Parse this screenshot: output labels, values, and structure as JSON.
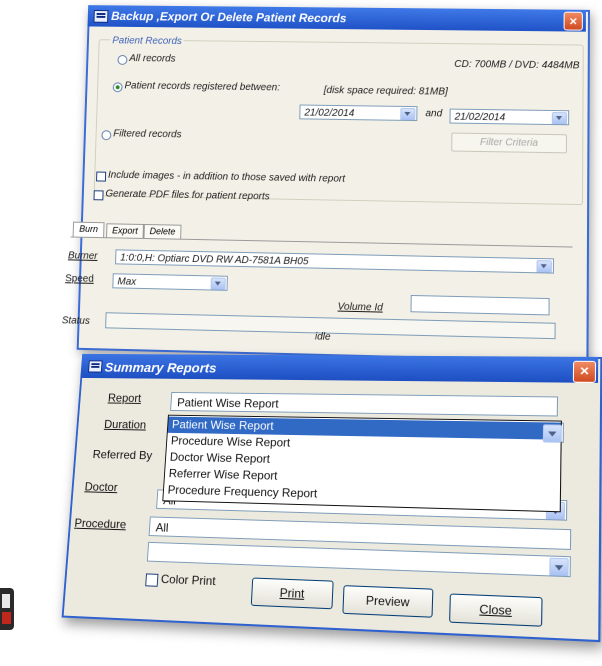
{
  "backup_window": {
    "title": "Backup ,Export Or Delete Patient Records",
    "group_label": "Patient Records",
    "all_records": "All records",
    "capacity": "CD: 700MB / DVD: 4484MB",
    "registered_between": "Patient records registered between:",
    "disk_space": "[disk space required: 81MB]",
    "date_from": "21/02/2014",
    "date_and": "and",
    "date_to": "21/02/2014",
    "filtered_records": "Filtered records",
    "filter_criteria_button": "Filter Criteria",
    "include_images": "Include images - in addition to those saved with report",
    "generate_pdf": "Generate PDF files for patient reports",
    "tabs": [
      "Burn",
      "Export",
      "Delete"
    ],
    "burner_label": "Burner",
    "burner_value": "1:0:0,H: Optiarc  DVD RW AD-7581A  BH05",
    "speed_label": "Speed",
    "speed_value": "Max",
    "volume_label": "Volume Id",
    "status_label": "Status",
    "status_value": "idle"
  },
  "summary_window": {
    "title": "Summary Reports",
    "labels": {
      "report": "Report",
      "duration": "Duration",
      "referred_by": "Referred By",
      "doctor": "Doctor",
      "procedure": "Procedure"
    },
    "report_value": "Patient Wise Report",
    "doctor_value": "All",
    "procedure_value": "All",
    "dropdown_items": [
      "Patient Wise Report",
      "Procedure Wise Report",
      "Doctor Wise Report",
      "Referrer Wise Report",
      "Procedure Frequency Report"
    ],
    "color_print": "Color Print",
    "buttons": {
      "print": "Print",
      "preview": "Preview",
      "close": "Close"
    }
  },
  "colors": {
    "titlebar": "#2458d0",
    "selection": "#316ac5",
    "window_bg": "#f3f1e7",
    "close_button": "#d9532a"
  }
}
